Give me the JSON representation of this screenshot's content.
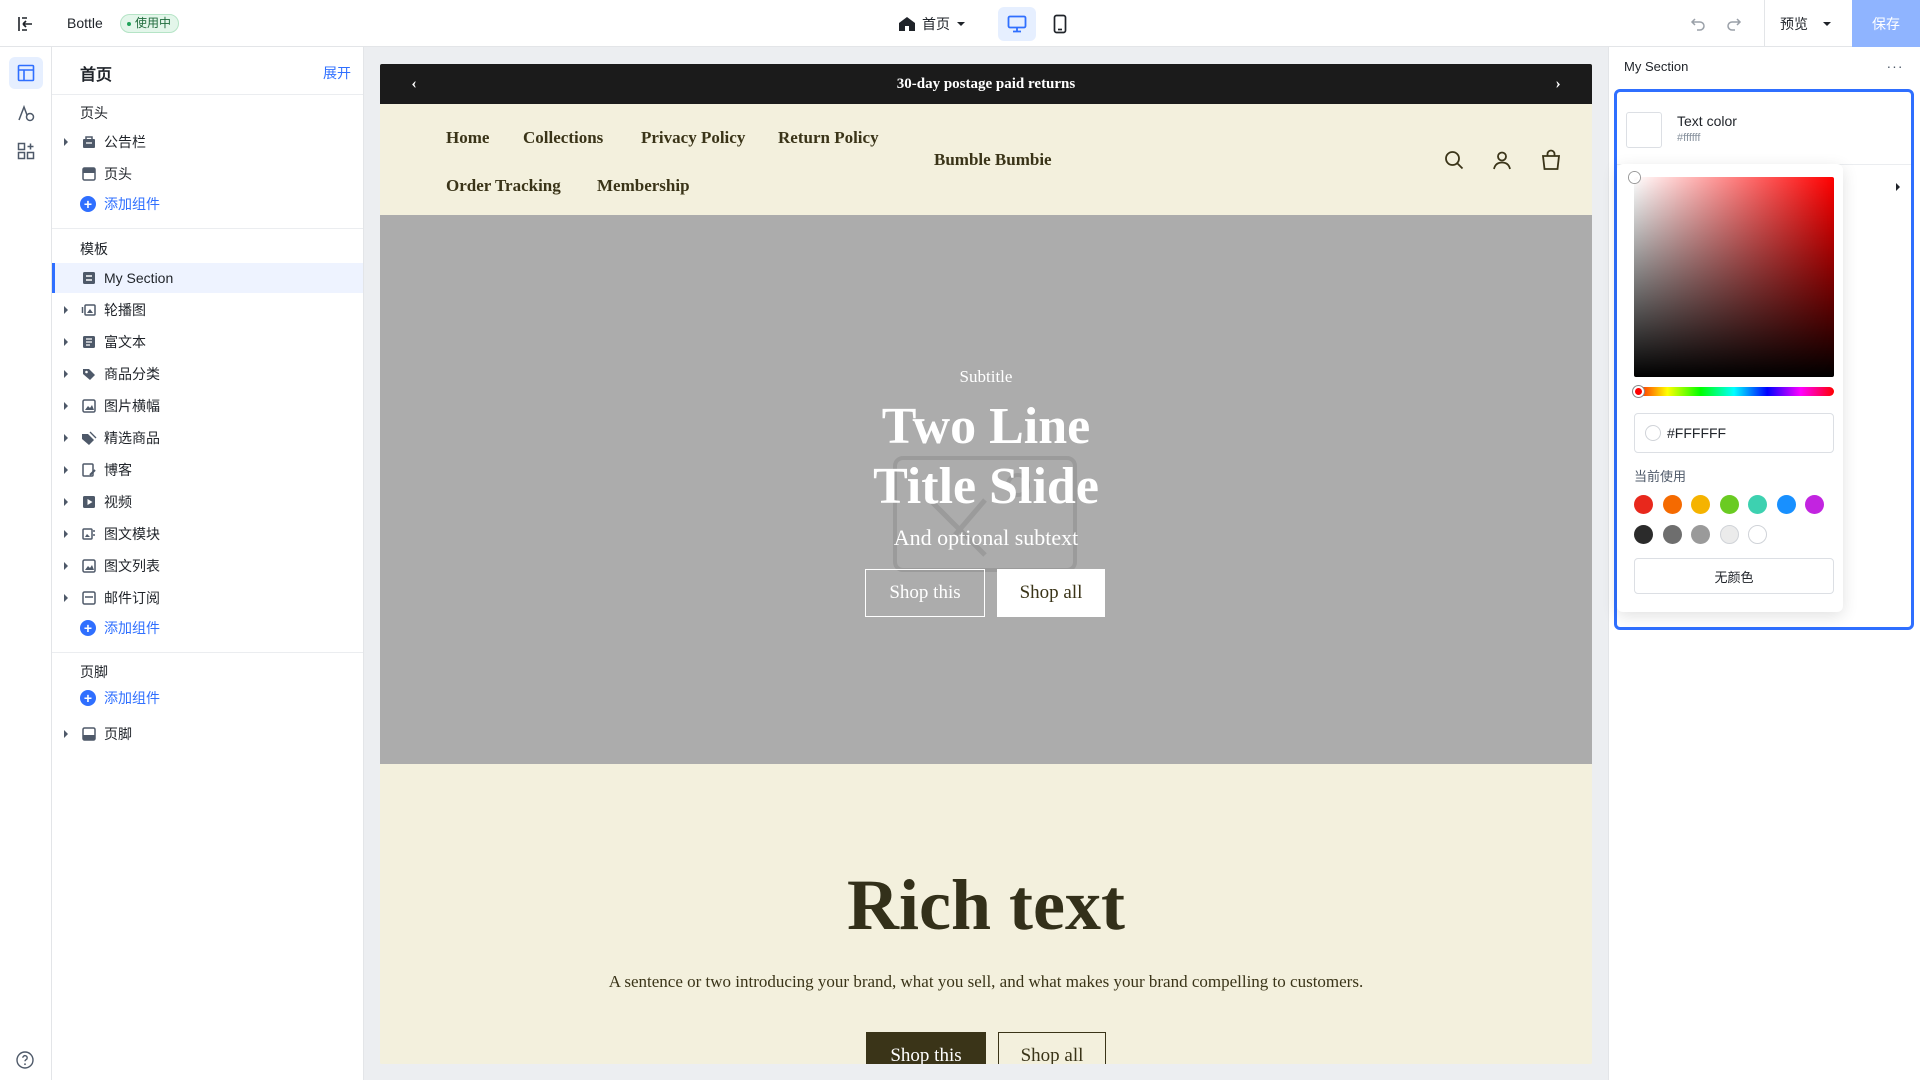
{
  "topbar": {
    "theme_name": "Bottle",
    "status_badge": "使用中",
    "current_page": "首页",
    "preview_label": "预览",
    "save_label": "保存"
  },
  "left_panel": {
    "title": "首页",
    "expand_label": "展开",
    "header_group": {
      "label": "页头",
      "items": [
        {
          "label": "公告栏",
          "icon": "megaphone-icon",
          "has_children": true
        },
        {
          "label": "页头",
          "icon": "header-layout-icon",
          "has_children": false
        }
      ],
      "add_label": "添加组件"
    },
    "template_group": {
      "label": "模板",
      "items": [
        {
          "label": "My Section",
          "icon": "section-icon",
          "has_children": false,
          "selected": true
        },
        {
          "label": "轮播图",
          "icon": "slideshow-icon",
          "has_children": true
        },
        {
          "label": "富文本",
          "icon": "rich-text-icon",
          "has_children": true
        },
        {
          "label": "商品分类",
          "icon": "collection-tag-icon",
          "has_children": true
        },
        {
          "label": "图片横幅",
          "icon": "image-banner-icon",
          "has_children": true
        },
        {
          "label": "精选商品",
          "icon": "featured-tag-icon",
          "has_children": true
        },
        {
          "label": "博客",
          "icon": "blog-icon",
          "has_children": true
        },
        {
          "label": "视频",
          "icon": "video-icon",
          "has_children": true
        },
        {
          "label": "图文模块",
          "icon": "image-text-icon",
          "has_children": true
        },
        {
          "label": "图文列表",
          "icon": "image-list-icon",
          "has_children": true
        },
        {
          "label": "邮件订阅",
          "icon": "newsletter-icon",
          "has_children": true
        }
      ],
      "add_label": "添加组件"
    },
    "footer_group": {
      "label": "页脚",
      "add_label": "添加组件",
      "items": [
        {
          "label": "页脚",
          "icon": "footer-layout-icon",
          "has_children": true
        }
      ]
    }
  },
  "store": {
    "announcement": "30-day postage paid returns",
    "nav_row1": [
      "Home",
      "Collections",
      "Privacy Policy",
      "Return Policy"
    ],
    "nav_row2": [
      "Order Tracking",
      "Membership"
    ],
    "brand": "Bumble Bumbie",
    "hero": {
      "subtitle": "Subtitle",
      "title_line1": "Two Line",
      "title_line2": "Title Slide",
      "subtext": "And optional subtext",
      "button_outline": "Shop this",
      "button_solid": "Shop all"
    },
    "rich_text": {
      "title": "Rich text",
      "body": "A sentence or two introducing your brand, what you sell, and what makes your brand compelling to customers.",
      "button_solid": "Shop this",
      "button_outline": "Shop all"
    }
  },
  "settings": {
    "section_title": "My Section",
    "more_label": "···",
    "color_setting": {
      "name": "Text color",
      "value": "#ffffff"
    },
    "picker": {
      "hex_value": "#FFFFFF",
      "recent_label": "当前使用",
      "recent_colors": [
        "#e8281c",
        "#f56a00",
        "#f5b300",
        "#6acb22",
        "#3dd1b0",
        "#1890ff",
        "#c224e0",
        "#2b2b2b",
        "#6e6e6e",
        "#9a9a9a",
        "#ebebeb",
        "#ffffff"
      ],
      "no_color_label": "无颜色"
    }
  },
  "colors": {
    "accent": "#2f6fff",
    "save_button": "#8fb4ff",
    "announcement_bg": "#1b1b1b",
    "store_bg": "#f3f0dd",
    "hero_bg": "#acacac",
    "store_text": "#3a3418"
  }
}
